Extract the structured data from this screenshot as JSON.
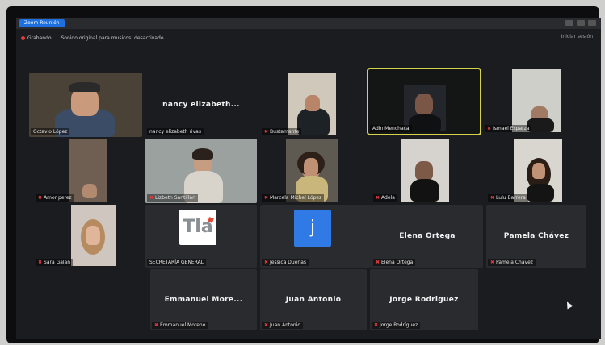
{
  "window": {
    "app_label": "Zoom Reunión"
  },
  "recording": {
    "status": "Grabando",
    "sound_setting": "Sonido original para musicos: desactivado",
    "stop_label": "Iniciar sesión"
  },
  "participants": [
    {
      "name": "Octavio López",
      "type": "video",
      "muted": false
    },
    {
      "name": "nancy elizabeth rivas",
      "display_name": "nancy elizabeth...",
      "type": "name",
      "muted": false
    },
    {
      "name": "Bustamante",
      "type": "video",
      "muted": true
    },
    {
      "name": "Adin Menchaca",
      "type": "video",
      "muted": false,
      "active_speaker": true
    },
    {
      "name": "Ismael Esparza",
      "type": "video",
      "muted": true
    },
    {
      "name": "Amor perez",
      "type": "video",
      "muted": true
    },
    {
      "name": "Lizbeth Santillan",
      "type": "video",
      "muted": true
    },
    {
      "name": "Marcela Michel López",
      "type": "video",
      "muted": true
    },
    {
      "name": "Adela",
      "type": "video",
      "muted": true
    },
    {
      "name": "Lulu Barrera",
      "type": "video",
      "muted": true
    },
    {
      "name": "Sara Galan",
      "type": "video",
      "muted": true
    },
    {
      "name": "SECRETARÍA GENERAL",
      "type": "logo",
      "logo_text": "Tla",
      "muted": false
    },
    {
      "name": "Jessica Dueñas",
      "type": "avatar",
      "avatar_letter": "j",
      "muted": true
    },
    {
      "name": "Elena Ortega",
      "display_name": "Elena Ortega",
      "type": "name",
      "muted": true
    },
    {
      "name": "Pamela Chávez",
      "display_name": "Pamela Chávez",
      "type": "name",
      "muted": true
    },
    {
      "name": "Emmanuel Moreno",
      "display_name": "Emmanuel More...",
      "type": "name",
      "muted": true
    },
    {
      "name": "Juan Antonio",
      "display_name": "Juan Antonio",
      "type": "name",
      "muted": true
    },
    {
      "name": "Jorge Rodríguez",
      "display_name": "Jorge Rodriguez",
      "type": "name",
      "muted": true
    }
  ],
  "colors": {
    "tile_bg": "#2a2b2e",
    "active_speaker": "#d6d24a",
    "muted_icon": "#e23b3b",
    "avatar_blue": "#2f7ae5"
  }
}
